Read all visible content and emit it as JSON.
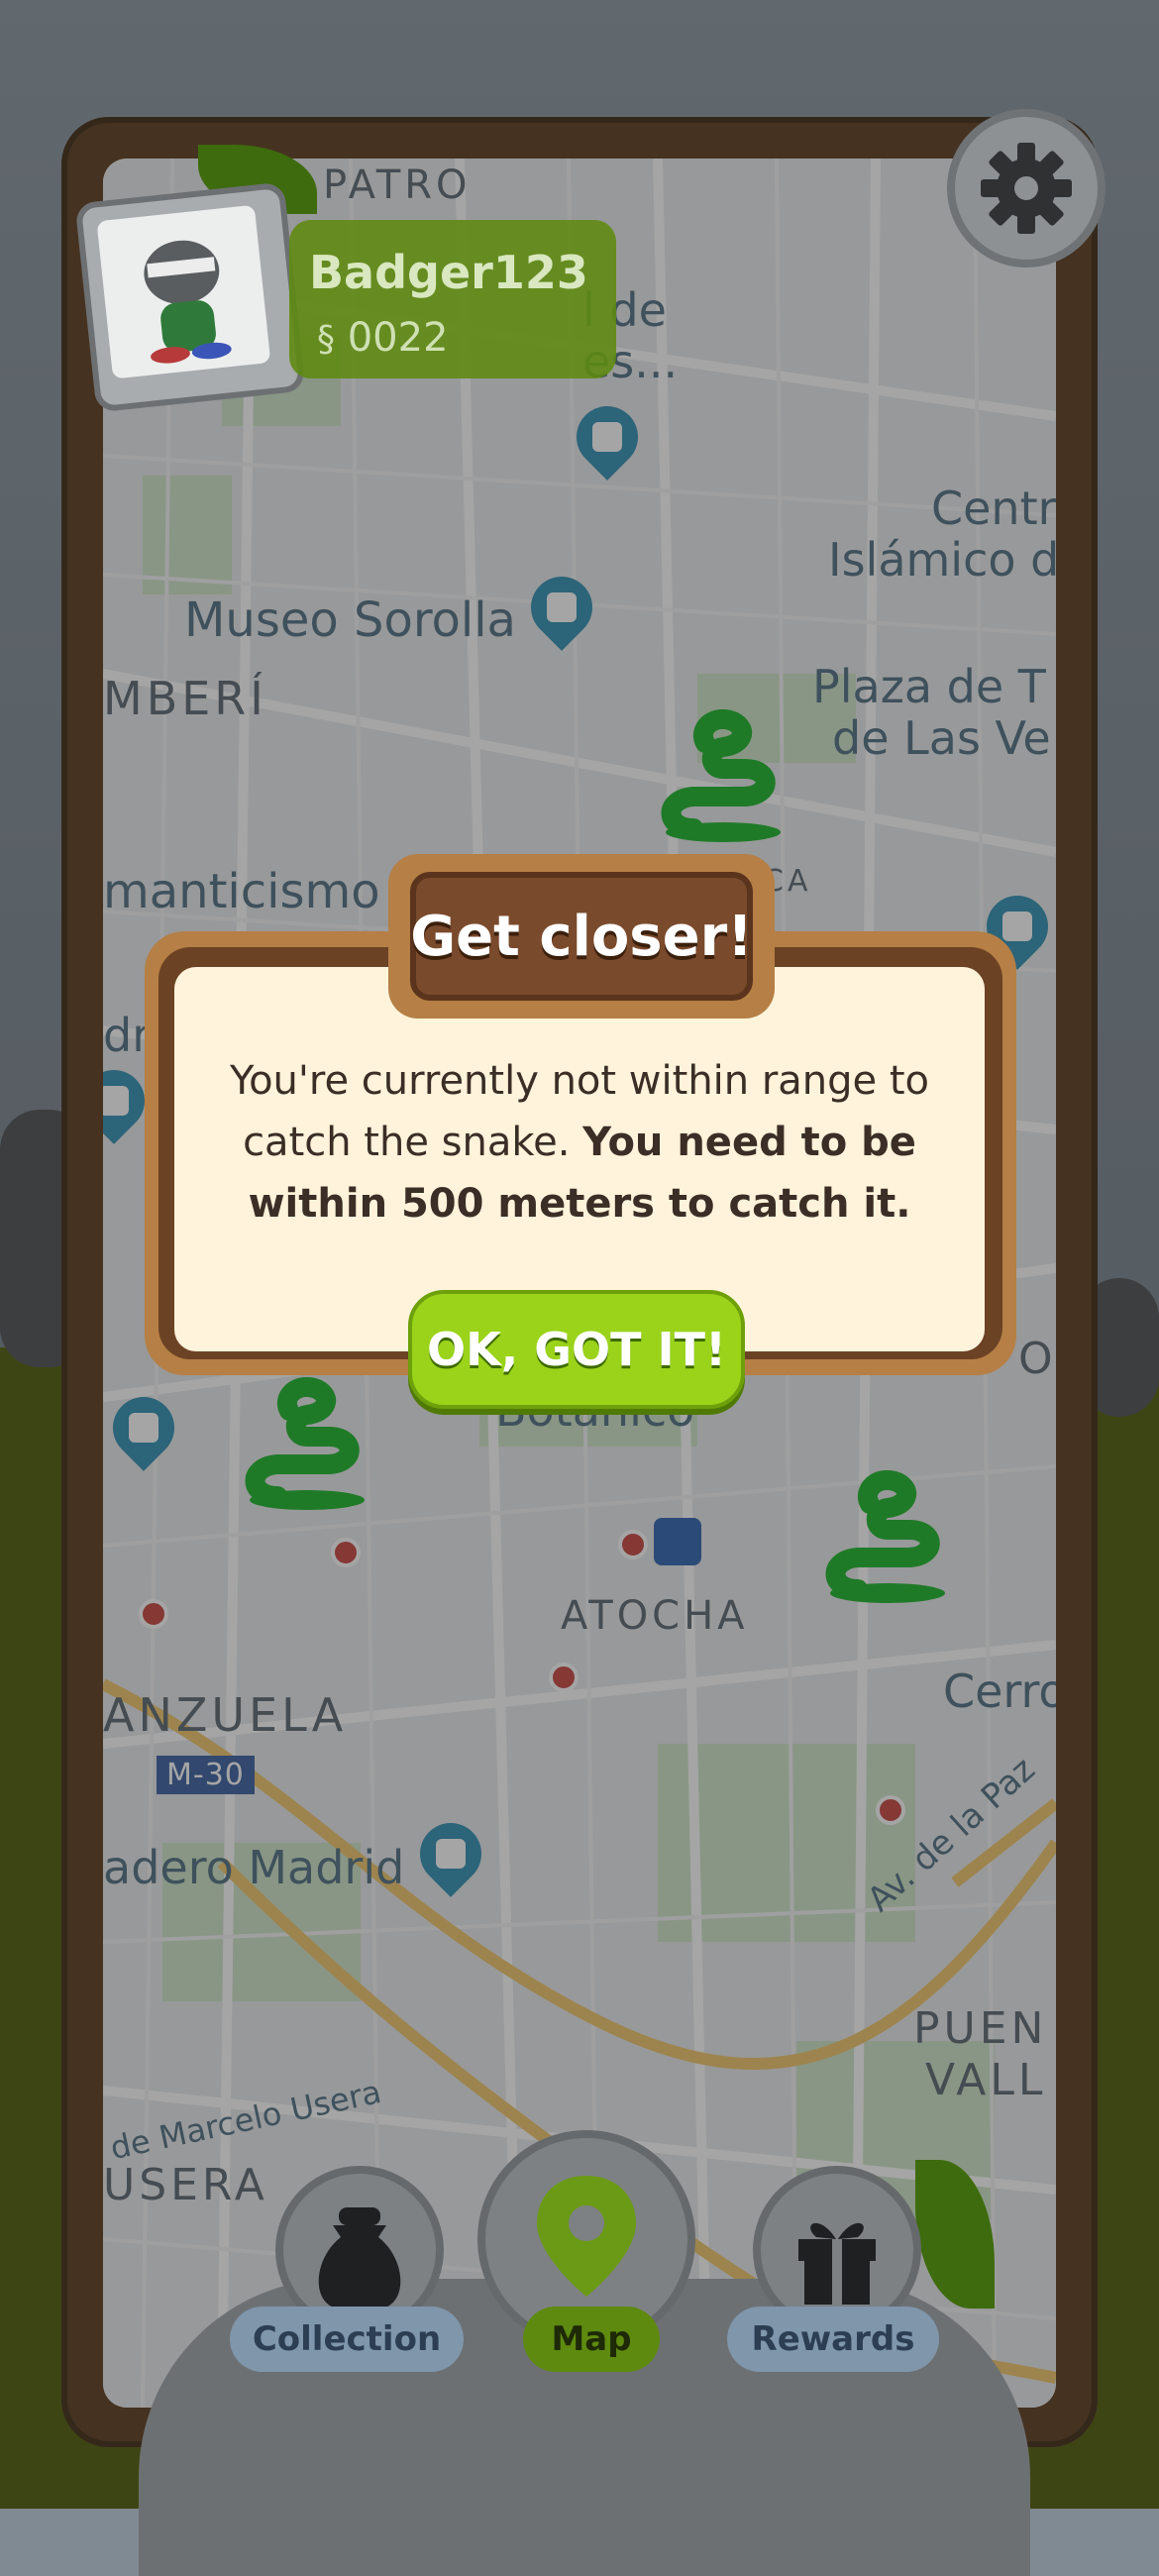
{
  "map": {
    "labels": {
      "patro": "PATRO",
      "museo_partial_1": "l de",
      "museo_partial_2": "es...",
      "centro_partial": "Centr",
      "islamico_partial": "Islámico d",
      "museo_sorolla": "Museo Sorolla",
      "chamberi_partial": "MBERÍ",
      "plaza_partial_1": "Plaza de T",
      "plaza_partial_2": "de Las Ve",
      "romanticismo_partial": "manticismo",
      "botanico_partial": "Botánico",
      "atocha": "ATOCHA",
      "arganzuela_partial": "ANZUELA",
      "m30": "M-30",
      "matadero_partial": "adero Madrid",
      "av_paz": "Av. de la Paz",
      "cerro_partial": "Cerro",
      "puente_partial_1": "PUEN",
      "puente_partial_2": "VALL",
      "marcelo_partial": "de Marcelo Usera",
      "usera_partial": "USERA",
      "ca_partial": "CA",
      "o_partial": "O",
      "dri_partial": "dri"
    }
  },
  "profile": {
    "username": "Badger123",
    "snake_count": "0022"
  },
  "dialog": {
    "title": "Get closer!",
    "message_plain": "You're currently not within range to catch the snake. ",
    "message_bold": "You need to be within 500 meters to catch it.",
    "button": "OK, GOT IT!"
  },
  "nav": {
    "collection": "Collection",
    "map": "Map",
    "rewards": "Rewards"
  },
  "colors": {
    "accent_green": "#9ad31a",
    "dialog_brown": "#7a4a2c",
    "dialog_cream": "#fff3db",
    "snake_green": "#1f8a2a"
  }
}
